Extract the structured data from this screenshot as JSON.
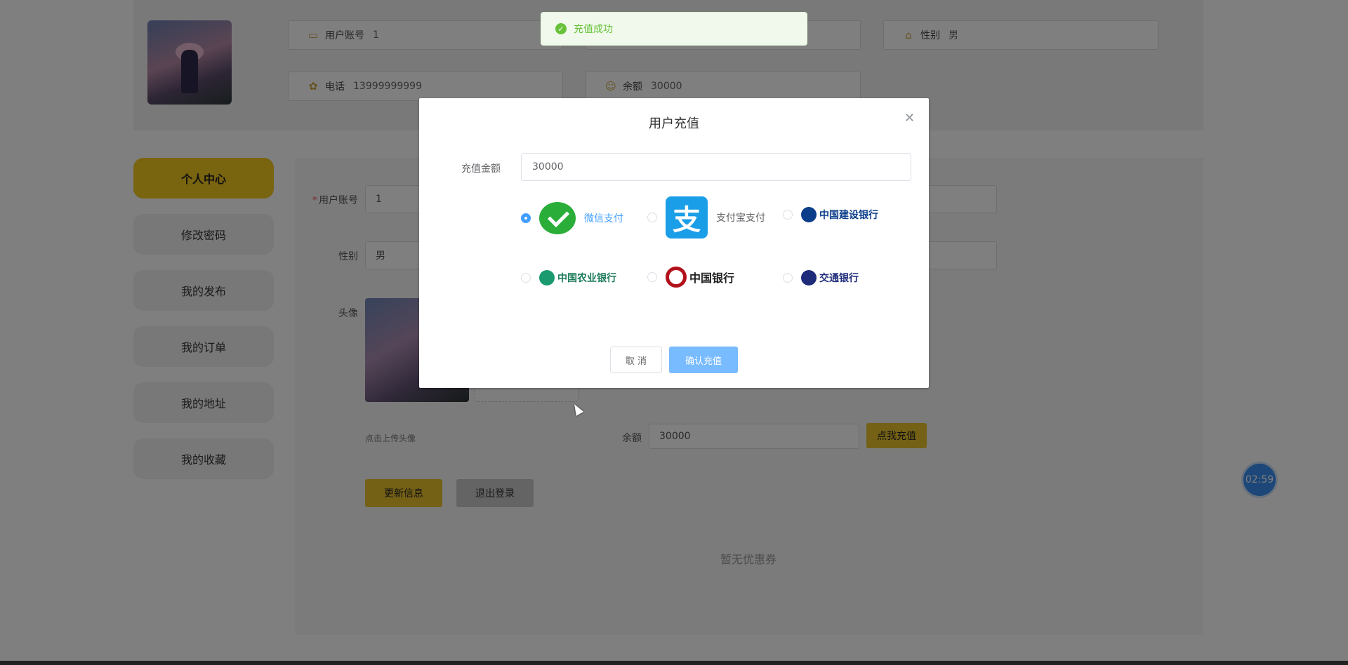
{
  "header": {
    "fields": [
      {
        "label": "用户账号",
        "value": "1",
        "icon": "id-card-icon"
      },
      {
        "label": "性别",
        "value": "男",
        "icon": "home-icon"
      },
      {
        "label": "电话",
        "value": "13999999999",
        "icon": "phone-icon"
      },
      {
        "label": "余额",
        "value": "30000",
        "icon": "user-icon"
      }
    ]
  },
  "sidebar": {
    "items": [
      {
        "label": "个人中心",
        "active": true
      },
      {
        "label": "修改密码"
      },
      {
        "label": "我的发布"
      },
      {
        "label": "我的订单"
      },
      {
        "label": "我的地址"
      },
      {
        "label": "我的收藏"
      }
    ]
  },
  "form": {
    "account_label": "用户账号",
    "account_value": "1",
    "gender_label": "性别",
    "gender_value": "男",
    "avatar_label": "头像",
    "upload_hint": "点击上传头像",
    "balance_label": "余额",
    "balance_value": "30000",
    "recharge_button": "点我充值",
    "update_button": "更新信息",
    "logout_button": "退出登录",
    "empty_coupons": "暂无优惠券"
  },
  "timer": "02:59",
  "toast": {
    "message": "充值成功"
  },
  "dialog": {
    "title": "用户充值",
    "amount_label": "充值金额",
    "amount_value": "30000",
    "payment_options": [
      {
        "label": "微信支付",
        "selected": true
      },
      {
        "label": "支付宝支付"
      },
      {
        "label": "中国建设银行"
      },
      {
        "label": "中国农业银行"
      },
      {
        "label": "中国银行"
      },
      {
        "label": "交通银行"
      }
    ],
    "cancel_button": "取 消",
    "confirm_button": "确认充值"
  },
  "colors": {
    "accent": "#f2c81f",
    "primary": "#409eff",
    "success": "#67c23a"
  }
}
